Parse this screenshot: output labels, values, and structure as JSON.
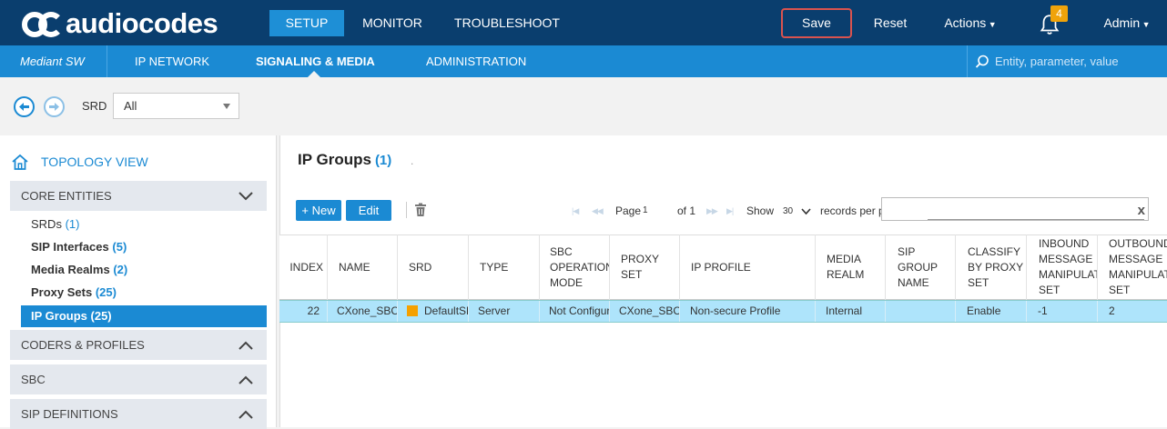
{
  "app": {
    "logo_text": "audiocodes"
  },
  "topnav": {
    "tabs": [
      {
        "label": "SETUP",
        "active": true
      },
      {
        "label": "MONITOR",
        "active": false
      },
      {
        "label": "TROUBLESHOOT",
        "active": false
      }
    ],
    "save_label": "Save",
    "reset_label": "Reset",
    "actions_label": "Actions",
    "notification_count": "4",
    "user_label": "Admin"
  },
  "subnav": {
    "product": "Mediant SW",
    "tabs": [
      {
        "label": "IP NETWORK",
        "active": false
      },
      {
        "label": "SIGNALING & MEDIA",
        "active": true
      },
      {
        "label": "ADMINISTRATION",
        "active": false
      }
    ],
    "search_placeholder": "Entity, parameter, value"
  },
  "srd_filter": {
    "label": "SRD",
    "value": "All"
  },
  "sidebar": {
    "topology_label": "TOPOLOGY VIEW",
    "sections": [
      {
        "label": "CORE ENTITIES",
        "expanded": true
      },
      {
        "label": "CODERS & PROFILES",
        "expanded": false
      },
      {
        "label": "SBC",
        "expanded": false
      },
      {
        "label": "SIP DEFINITIONS",
        "expanded": false
      }
    ],
    "items": [
      {
        "label": "SRDs",
        "count": "(1)",
        "bold": false,
        "selected": false
      },
      {
        "label": "SIP Interfaces",
        "count": "(5)",
        "bold": true,
        "selected": false
      },
      {
        "label": "Media Realms",
        "count": "(2)",
        "bold": true,
        "selected": false
      },
      {
        "label": "Proxy Sets",
        "count": "(25)",
        "bold": true,
        "selected": false
      },
      {
        "label": "IP Groups",
        "count": "(25)",
        "bold": true,
        "selected": true
      }
    ]
  },
  "main": {
    "title": "IP Groups",
    "title_count": "(1)",
    "title_dot": ".",
    "new_label": "+ New",
    "edit_label": "Edit",
    "pager": {
      "page_label": "Page",
      "page_value": "1",
      "of_label": "of 1",
      "show_label": "Show",
      "show_value": "30",
      "records_label": "records per page",
      "clear_glyph": "x"
    },
    "columns": [
      "INDEX",
      "NAME",
      "SRD",
      "TYPE",
      "SBC OPERATION MODE",
      "PROXY SET",
      "IP PROFILE",
      "MEDIA REALM",
      "SIP GROUP NAME",
      "CLASSIFY BY PROXY SET",
      "INBOUND MESSAGE MANIPULATION SET",
      "OUTBOUND MESSAGE MANIPULATION SET"
    ],
    "rows": [
      {
        "cells": [
          "22",
          "CXone_SBC",
          "DefaultSRD",
          "Server",
          "Not Configured",
          "CXone_SBC",
          "Non-secure Profile",
          "Internal",
          "",
          "Enable",
          "-1",
          "2"
        ]
      }
    ]
  },
  "colors": {
    "topbar": "#0a3e6e",
    "accent": "#1b8ad3",
    "selected_row": "#aee4fb",
    "save_border": "#d9534f",
    "badge": "#f0a30a"
  }
}
